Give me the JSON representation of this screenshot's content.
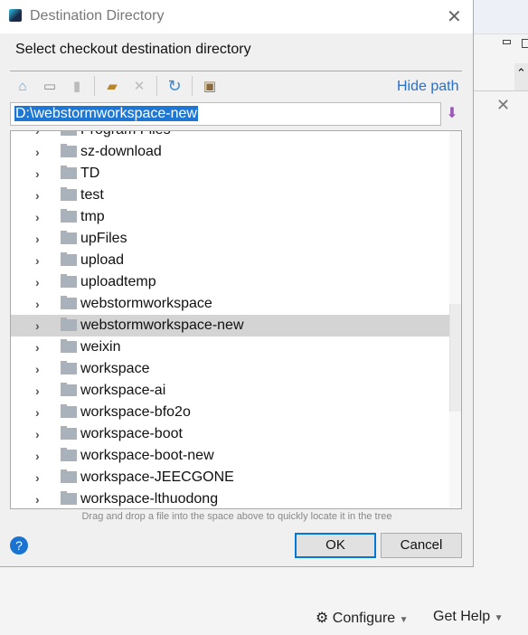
{
  "dialog": {
    "title": "Destination Directory",
    "heading": "Select checkout destination directory",
    "hide_path": "Hide path",
    "path": "D:\\webstormworkspace-new",
    "hint": "Drag and drop a file into the space above to quickly locate it in the tree",
    "ok": "OK",
    "cancel": "Cancel",
    "help": "?"
  },
  "toolbar": [
    "home-icon",
    "desktop-icon",
    "project-folder-icon",
    "new-folder-icon",
    "delete-icon",
    "refresh-icon",
    "show-hidden-icon"
  ],
  "tree": {
    "items": [
      "Program Files",
      "sz-download",
      "TD",
      "test",
      "tmp",
      "upFiles",
      "upload",
      "uploadtemp",
      "webstormworkspace",
      "webstormworkspace-new",
      "weixin",
      "workspace",
      "workspace-ai",
      "workspace-bfo2o",
      "workspace-boot",
      "workspace-boot-new",
      "workspace-JEECGONE",
      "workspace-lthuodong"
    ],
    "selected": "webstormworkspace-new"
  },
  "footer": {
    "configure": "Configure",
    "get_help": "Get Help"
  }
}
